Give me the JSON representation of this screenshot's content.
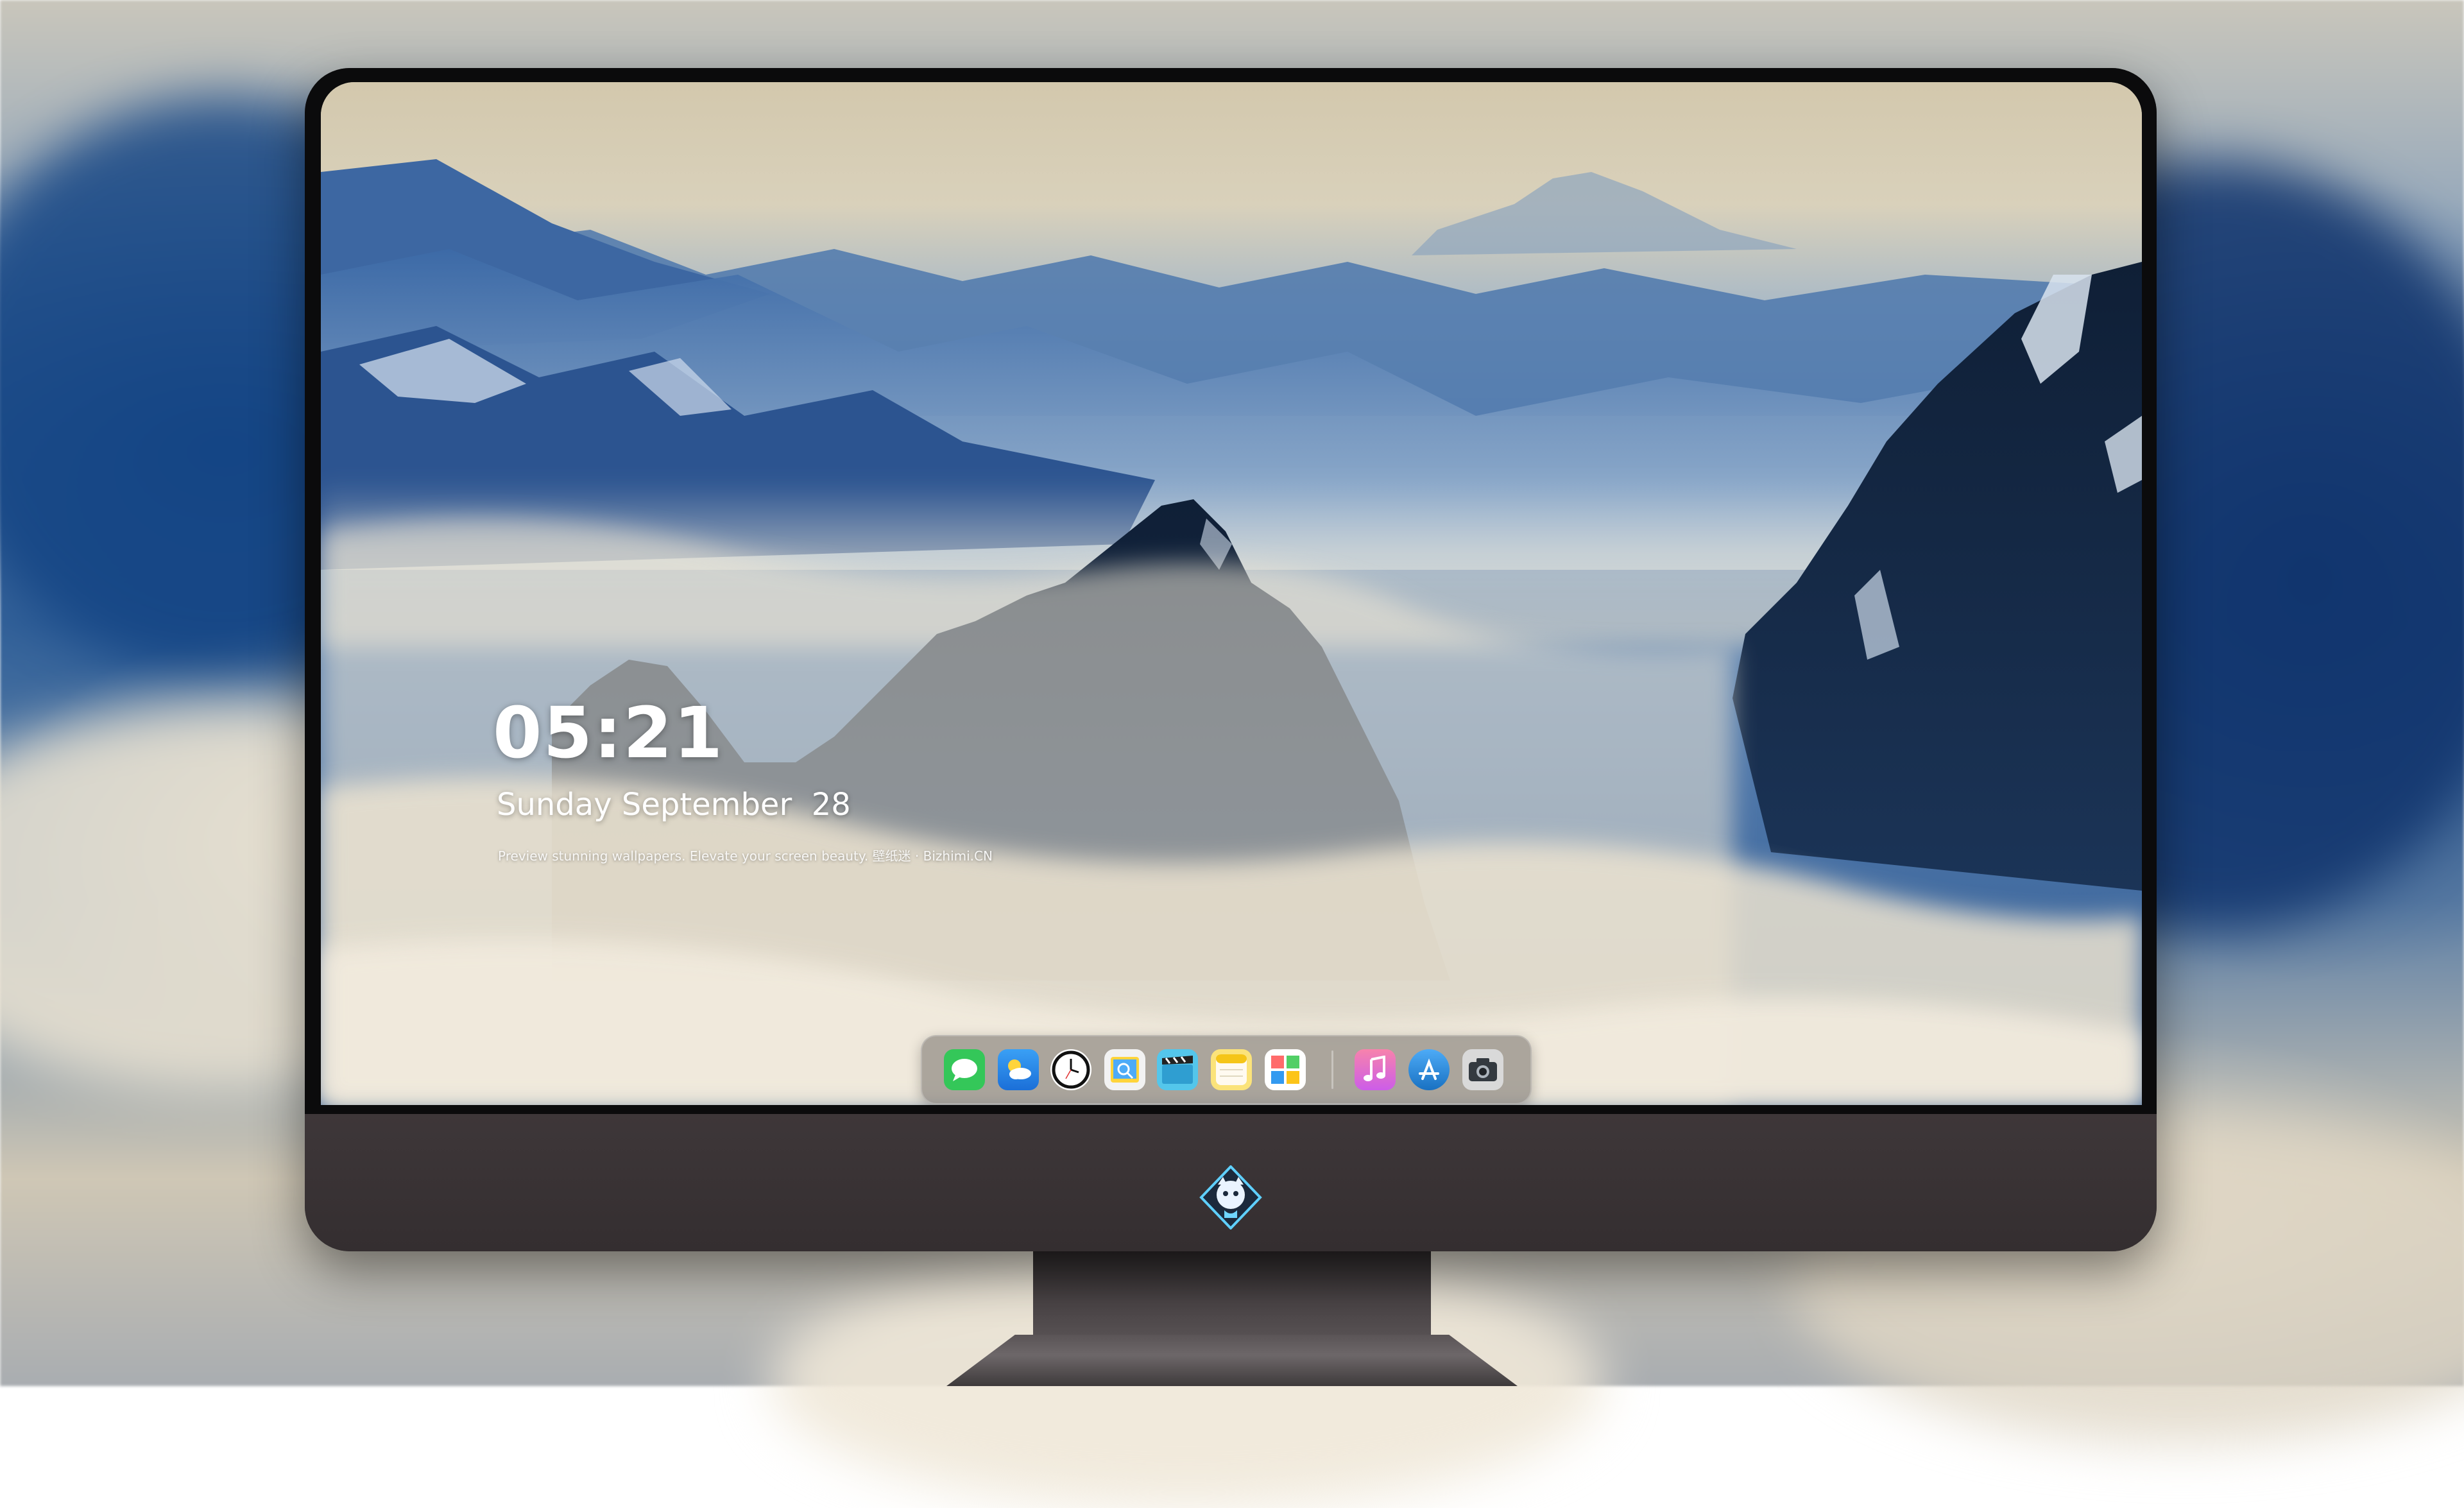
{
  "lockscreen": {
    "time": "05:21",
    "date": "Sunday September  28",
    "tagline": "Preview stunning wallpapers. Elevate your screen beauty. 壁纸迷 · Bizhimi.CN"
  },
  "dock": {
    "apps": [
      {
        "icon": "messages-icon"
      },
      {
        "icon": "weather-icon"
      },
      {
        "icon": "clock-icon"
      },
      {
        "icon": "preview-icon"
      },
      {
        "icon": "video-clapper-icon"
      },
      {
        "icon": "notes-icon"
      },
      {
        "icon": "photo-gallery-icon"
      },
      {
        "icon": "music-icon"
      },
      {
        "icon": "app-store-icon"
      },
      {
        "icon": "camera-icon"
      }
    ]
  },
  "colors": {
    "monitor_body": "#3a3436",
    "bezel": "#0b0b0c",
    "text": "#ffffff",
    "messages": "#34c759",
    "weather": "#2b8cf0",
    "music": "#e445c8",
    "app_store": "#1e8ef5"
  }
}
